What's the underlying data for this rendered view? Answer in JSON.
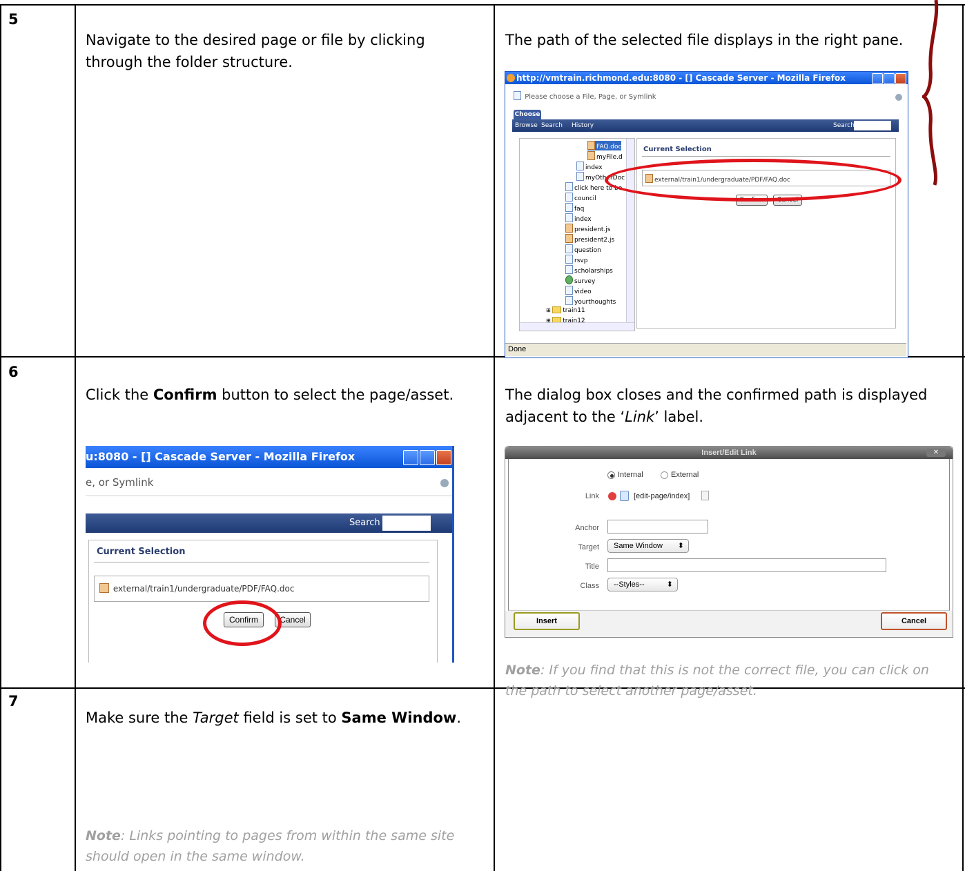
{
  "rows": [
    {
      "num": "5",
      "left_text": "Navigate to the desired page or file by clicking through the folder structure.",
      "right_text": "The path of the selected file displays in the right pane."
    },
    {
      "num": "6",
      "left_text_pre": "Click the ",
      "left_text_bold": "Confirm",
      "left_text_post": " button to select the page/asset.",
      "right_text_pre": "The dialog box closes and the confirmed path is displayed adjacent to the ‘",
      "right_text_italic": "Link",
      "right_text_post": "’ label.",
      "note_label": "Note",
      "note_text": ": If you find that this is not the correct file, you can click on the path to select another page/asset."
    },
    {
      "num": "7",
      "left_pre": "Make sure the ",
      "left_italic": "Target",
      "left_mid": " field is set to ",
      "left_bold": "Same Window",
      "left_post": ".",
      "note_label": "Note",
      "note_text": ": Links pointing to pages from within the same site should open in the same window."
    }
  ],
  "firefox1": {
    "title": "http://vmtrain.richmond.edu:8080 - [] Cascade Server - Mozilla Firefox",
    "subtitle": "Please choose a File, Page, or Symlink",
    "tab": "Choose",
    "nav": [
      "Browse",
      "Search",
      "History"
    ],
    "search_label": "Search",
    "tree": [
      "FAQ.doc",
      "myFile.d",
      "index",
      "myOtherDoc",
      "click here to be",
      "council",
      "faq",
      "index",
      "president.js",
      "president2.js",
      "question",
      "rsvp",
      "scholarships",
      "survey",
      "video",
      "yourthoughts",
      "train11",
      "train12"
    ],
    "current_selection": "Current Selection",
    "path": "external/train1/undergraduate/PDF/FAQ.doc",
    "confirm": "Confirm",
    "cancel": "Cancel",
    "status": "Done"
  },
  "firefox2": {
    "title": "u:8080 - [] Cascade Server - Mozilla Firefox",
    "subtitle": "e, or Symlink",
    "search_label": "Search",
    "current_selection": "Current Selection",
    "path": "external/train1/undergraduate/PDF/FAQ.doc",
    "confirm": "Confirm",
    "cancel": "Cancel"
  },
  "link_dialog": {
    "title": "Insert/Edit Link",
    "internal": "Internal",
    "external": "External",
    "link_label": "Link",
    "link_value": "[edit-page/index]",
    "anchor_label": "Anchor",
    "target_label": "Target",
    "target_value": "Same Window",
    "title_label": "Title",
    "class_label": "Class",
    "class_value": "--Styles--",
    "insert": "Insert",
    "cancel": "Cancel"
  }
}
